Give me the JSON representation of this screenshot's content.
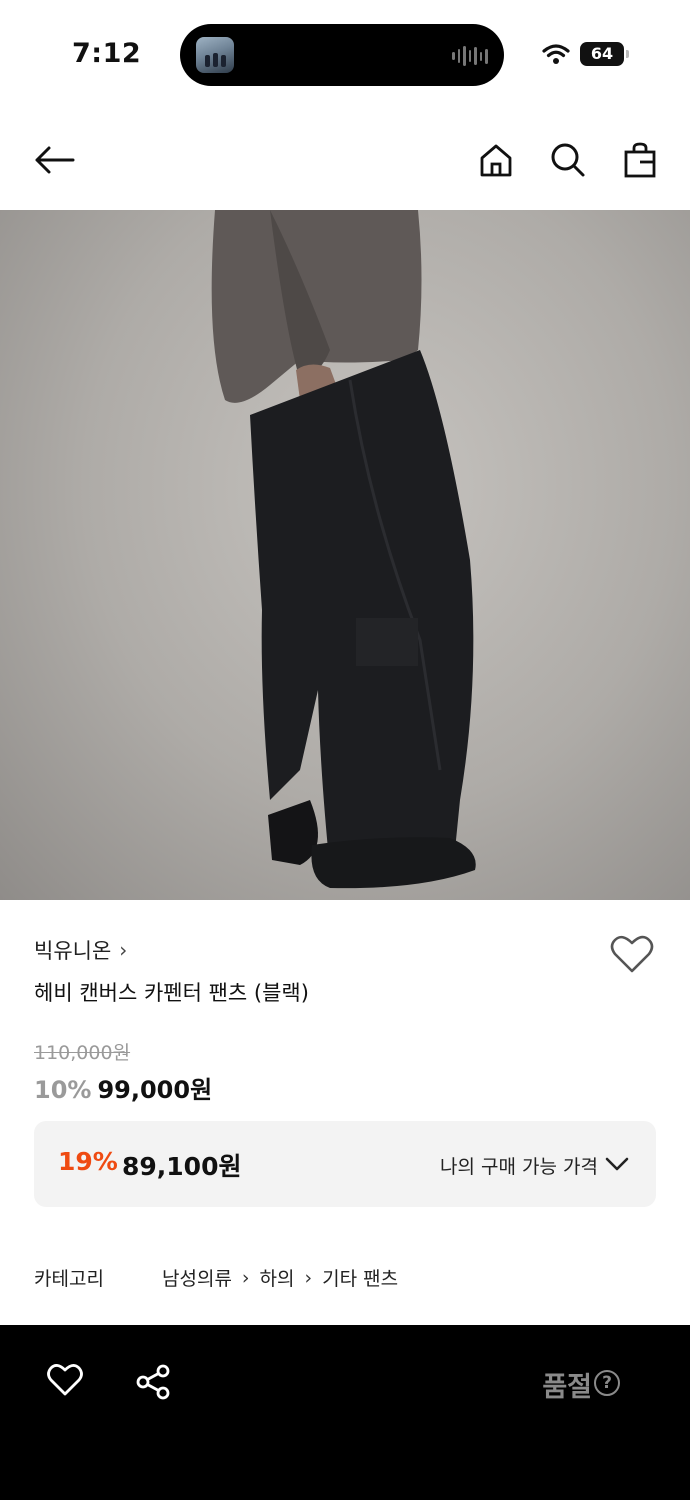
{
  "status_bar": {
    "time": "7:12",
    "battery": "64"
  },
  "product": {
    "brand": "빅유니온",
    "brand_chevron": "›",
    "title": "헤비 캔버스 카펜터 팬츠 (블랙)",
    "original_price": "110,000원",
    "discount_rate": "10%",
    "sale_price": "99,000원"
  },
  "coupon": {
    "rate": "19%",
    "price": "89,100원",
    "label": "나의 구매 가능 가격"
  },
  "category": {
    "label": "카테고리",
    "path": [
      "남성의류",
      "하의",
      "기타 팬츠"
    ],
    "separator": "›"
  },
  "bottom_bar": {
    "status": "품절",
    "help": "?"
  },
  "colors": {
    "accent": "#ef4b12",
    "muted": "#9a9a9a",
    "bottom_bar": "#000000"
  },
  "icons": [
    "back-arrow-icon",
    "home-icon",
    "search-icon",
    "shopping-bag-icon",
    "heart-icon",
    "share-icon",
    "help-icon",
    "chevron-down-icon"
  ]
}
